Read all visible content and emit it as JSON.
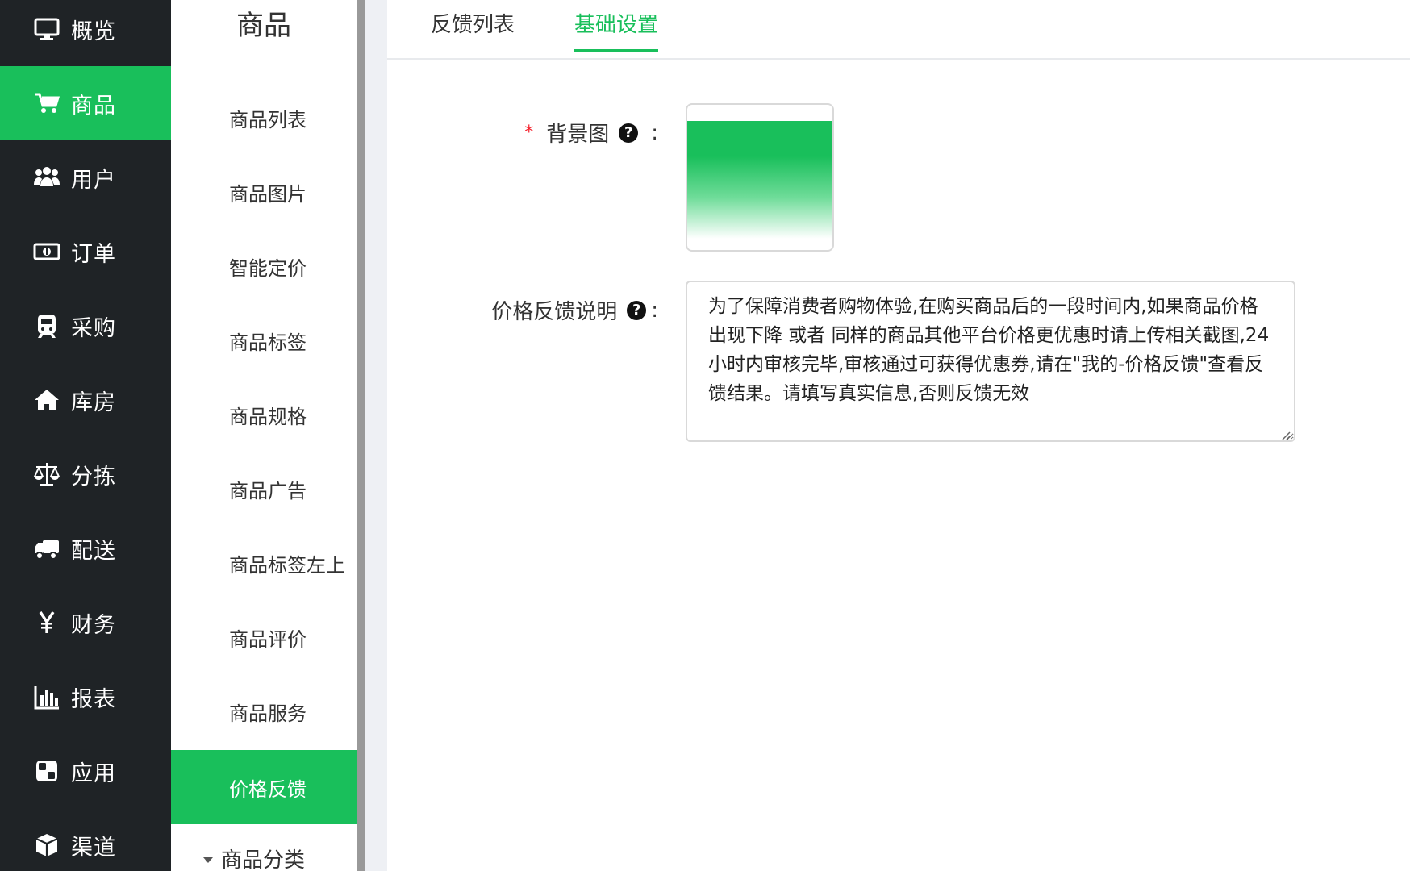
{
  "primary_nav": {
    "items": [
      {
        "label": "概览",
        "icon": "monitor-icon",
        "active": false
      },
      {
        "label": "商品",
        "icon": "cart-icon",
        "active": true
      },
      {
        "label": "用户",
        "icon": "users-icon",
        "active": false
      },
      {
        "label": "订单",
        "icon": "money-icon",
        "active": false
      },
      {
        "label": "采购",
        "icon": "train-icon",
        "active": false
      },
      {
        "label": "库房",
        "icon": "home-icon",
        "active": false
      },
      {
        "label": "分拣",
        "icon": "scale-icon",
        "active": false
      },
      {
        "label": "配送",
        "icon": "truck-icon",
        "active": false
      },
      {
        "label": "财务",
        "icon": "yen-icon",
        "active": false
      },
      {
        "label": "报表",
        "icon": "bar-chart-icon",
        "active": false
      },
      {
        "label": "应用",
        "icon": "apps-icon",
        "active": false
      },
      {
        "label": "渠道",
        "icon": "cube-icon",
        "active": false
      }
    ]
  },
  "secondary_nav": {
    "title": "商品",
    "items": [
      {
        "label": "商品列表",
        "active": false
      },
      {
        "label": "商品图片",
        "active": false
      },
      {
        "label": "智能定价",
        "active": false
      },
      {
        "label": "商品标签",
        "active": false
      },
      {
        "label": "商品规格",
        "active": false
      },
      {
        "label": "商品广告",
        "active": false
      },
      {
        "label": "商品标签左上",
        "active": false
      },
      {
        "label": "商品评价",
        "active": false
      },
      {
        "label": "商品服务",
        "active": false
      },
      {
        "label": "价格反馈",
        "active": true
      }
    ],
    "group": "商品分类"
  },
  "tabs": [
    {
      "label": "反馈列表",
      "active": false
    },
    {
      "label": "基础设置",
      "active": true
    }
  ],
  "form": {
    "background": {
      "required_mark": "*",
      "label": "背景图",
      "colon": ":"
    },
    "description": {
      "label": "价格反馈说明",
      "colon": ":",
      "value": "为了保障消费者购物体验,在购买商品后的一段时间内,如果商品价格出现下降 或者 同样的商品其他平台价格更优惠时请上传相关截图,24小时内审核完毕,审核通过可获得优惠券,请在\"我的-价格反馈\"查看反馈结果。请填写真实信息,否则反馈无效"
    },
    "help_glyph": "?"
  },
  "colors": {
    "accent": "#19bf5b",
    "sidebar_bg": "#1f2326",
    "required": "#f5222d"
  }
}
